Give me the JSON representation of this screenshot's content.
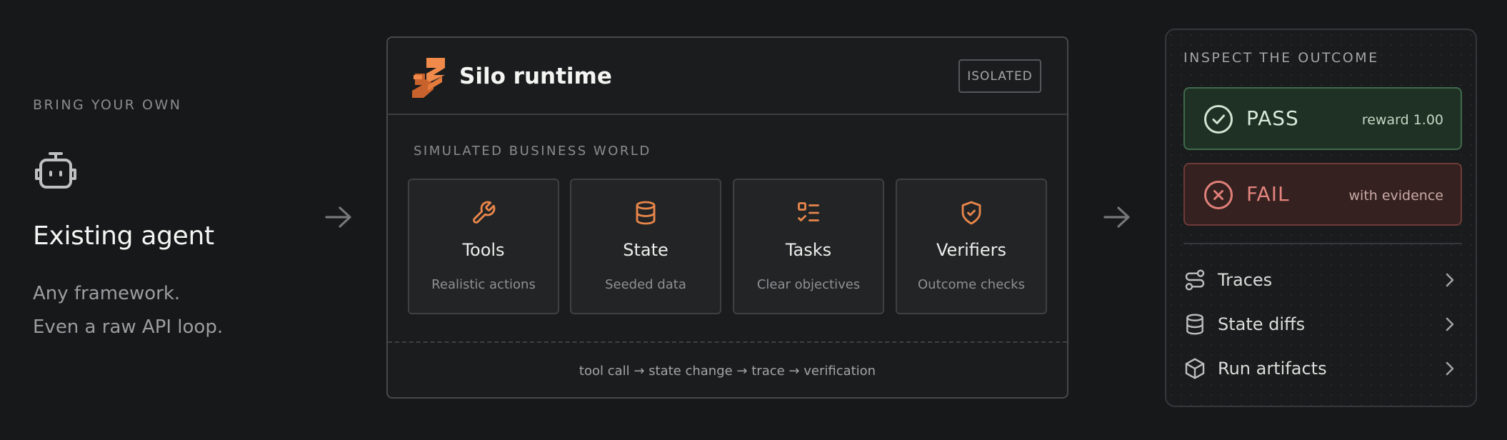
{
  "agent": {
    "eyebrow": "BRING YOUR OWN",
    "icon": "robot-icon",
    "title": "Existing agent",
    "desc_line1": "Any framework.",
    "desc_line2": "Even a raw API loop."
  },
  "runtime": {
    "logo": "silo-logo-icon",
    "title": "Silo runtime",
    "badge": "ISOLATED",
    "eyebrow": "SIMULATED BUSINESS WORLD",
    "cards": [
      {
        "icon": "wrench-icon",
        "title": "Tools",
        "subtitle": "Realistic actions"
      },
      {
        "icon": "database-icon",
        "title": "State",
        "subtitle": "Seeded data"
      },
      {
        "icon": "checklist-icon",
        "title": "Tasks",
        "subtitle": "Clear objectives"
      },
      {
        "icon": "shield-check-icon",
        "title": "Verifiers",
        "subtitle": "Outcome checks"
      }
    ],
    "flow": "tool call → state change → trace → verification"
  },
  "outcome": {
    "eyebrow": "INSPECT THE OUTCOME",
    "pass": {
      "label": "PASS",
      "note": "reward 1.00"
    },
    "fail": {
      "label": "FAIL",
      "note": "with evidence"
    },
    "rows": [
      {
        "icon": "route-icon",
        "label": "Traces"
      },
      {
        "icon": "database-icon",
        "label": "State diffs"
      },
      {
        "icon": "package-icon",
        "label": "Run artifacts"
      }
    ]
  },
  "colors": {
    "background": "#17181a",
    "accent": "#e8864a",
    "pass": "#3f6b4d",
    "fail": "#6d3b38"
  }
}
